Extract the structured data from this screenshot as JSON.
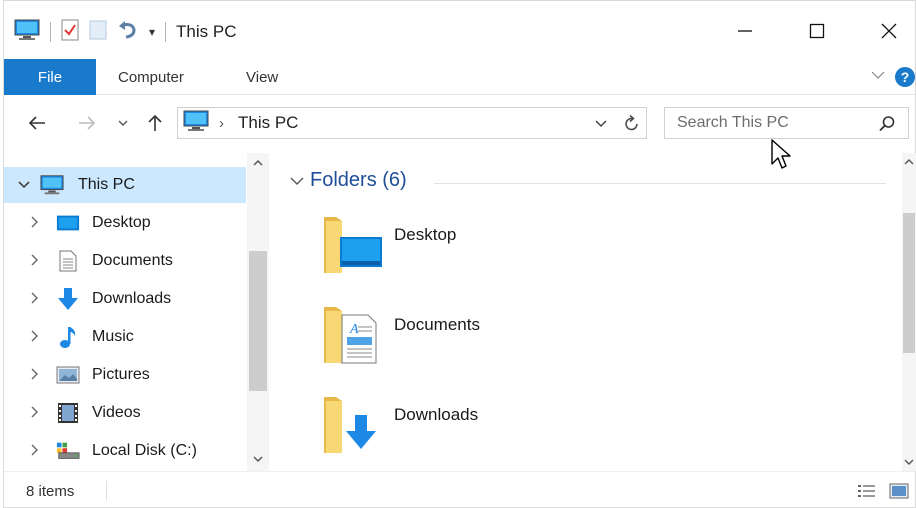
{
  "window": {
    "title": "This PC",
    "controls": {
      "minimize": "—",
      "maximize": "☐",
      "close": "✕"
    }
  },
  "ribbon": {
    "tabs": [
      {
        "label": "File",
        "active": true
      },
      {
        "label": "Computer"
      },
      {
        "label": "View"
      }
    ],
    "help": "?"
  },
  "address": {
    "path": "This PC",
    "separator": "›"
  },
  "search": {
    "placeholder": "Search This PC"
  },
  "nav_pane": {
    "items": [
      {
        "label": "This PC",
        "icon": "computer-icon",
        "expanded": true,
        "selected": true
      },
      {
        "label": "Desktop",
        "icon": "desktop-icon"
      },
      {
        "label": "Documents",
        "icon": "documents-icon"
      },
      {
        "label": "Downloads",
        "icon": "downloads-icon"
      },
      {
        "label": "Music",
        "icon": "music-icon"
      },
      {
        "label": "Pictures",
        "icon": "pictures-icon"
      },
      {
        "label": "Videos",
        "icon": "videos-icon"
      },
      {
        "label": "Local Disk (C:)",
        "icon": "local-disk-icon"
      }
    ]
  },
  "content": {
    "group_header": "Folders (6)",
    "folders": [
      {
        "label": "Desktop",
        "icon": "desktop-folder-icon"
      },
      {
        "label": "Documents",
        "icon": "documents-folder-icon"
      },
      {
        "label": "Downloads",
        "icon": "downloads-folder-icon"
      }
    ]
  },
  "status": {
    "item_count": "8 items"
  },
  "colors": {
    "accent": "#1979ca",
    "selection": "#cce8ff",
    "folder": "#f8d775",
    "folder_dark": "#e8b94a",
    "group_header": "#1f4e99"
  }
}
